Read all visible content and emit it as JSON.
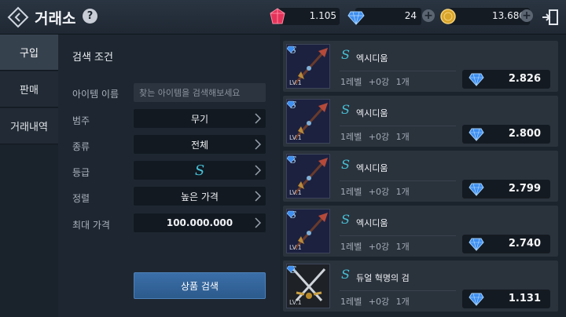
{
  "header": {
    "title": "거래소",
    "help": "?",
    "currencies": [
      {
        "name": "red-gem",
        "value": "1.105",
        "color": "#e5335a"
      },
      {
        "name": "blue-diamond",
        "value": "24",
        "color": "#3e8ef0"
      },
      {
        "name": "gold-coin",
        "value": "13.686",
        "color": "#d9a52a"
      }
    ],
    "plus": "+"
  },
  "nav": {
    "tabs": [
      {
        "label": "구입",
        "active": true
      },
      {
        "label": "판매",
        "active": false
      },
      {
        "label": "거래내역",
        "active": false
      }
    ]
  },
  "search": {
    "title": "검색 조건",
    "item_name_label": "아이템 이름",
    "item_name_placeholder": "찾는 아이템을 검색해보세요",
    "category_label": "범주",
    "category_value": "무기",
    "type_label": "종류",
    "type_value": "전체",
    "grade_label": "등급",
    "grade_value": "S",
    "sort_label": "정렬",
    "sort_value": "높은 가격",
    "max_price_label": "최대 가격",
    "max_price_value": "100.000.000",
    "submit_label": "상품 검색"
  },
  "listings": [
    {
      "grade": "S",
      "name": "엑시디움",
      "level_tag": "LV.1",
      "level": "1레벨",
      "enhance": "+0강",
      "qty": "1개",
      "price": "2.826",
      "weapon": "spear"
    },
    {
      "grade": "S",
      "name": "엑시디움",
      "level_tag": "LV.1",
      "level": "1레벨",
      "enhance": "+0강",
      "qty": "1개",
      "price": "2.800",
      "weapon": "spear"
    },
    {
      "grade": "S",
      "name": "엑시디움",
      "level_tag": "LV.1",
      "level": "1레벨",
      "enhance": "+0강",
      "qty": "1개",
      "price": "2.799",
      "weapon": "spear"
    },
    {
      "grade": "S",
      "name": "엑시디움",
      "level_tag": "LV.1",
      "level": "1레벨",
      "enhance": "+0강",
      "qty": "1개",
      "price": "2.740",
      "weapon": "spear"
    },
    {
      "grade": "S",
      "name": "듀얼 혁명의 검",
      "level_tag": "LV.1",
      "level": "1레벨",
      "enhance": "+0강",
      "qty": "1개",
      "price": "1.131",
      "weapon": "dual-swords"
    }
  ],
  "colors": {
    "accent": "#47c1d6",
    "button": "#2c5a8c"
  }
}
